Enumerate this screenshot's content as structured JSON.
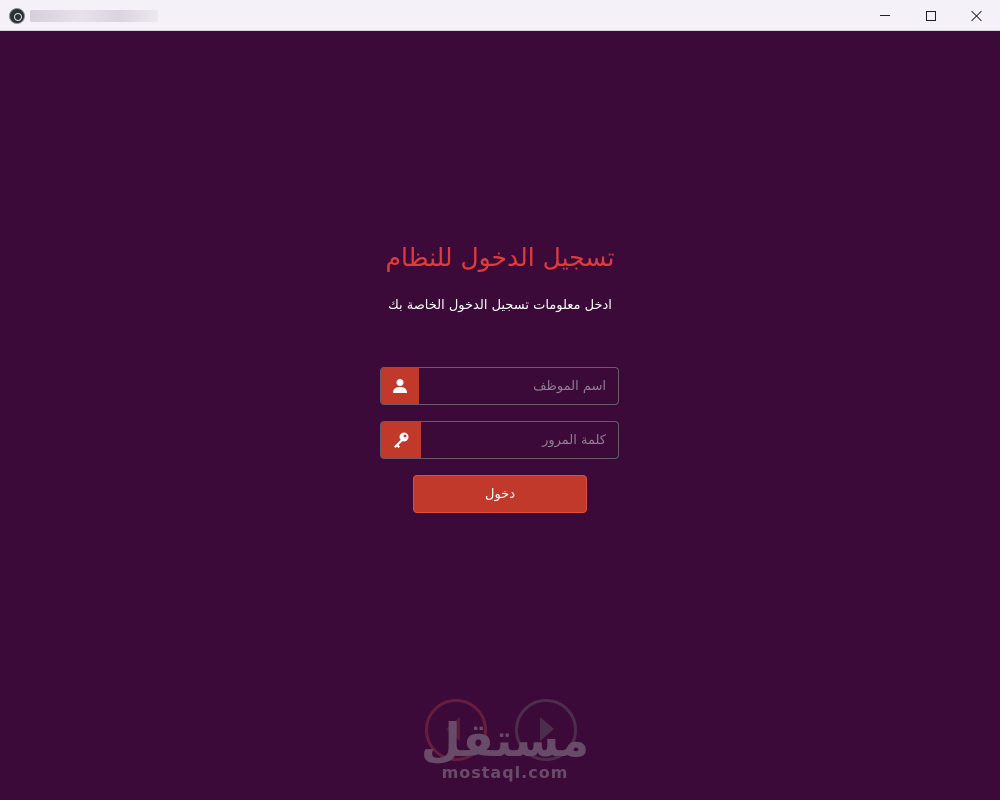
{
  "window": {
    "icon": "electron-app-icon",
    "controls": {
      "minimize": "minimize-icon",
      "maximize": "maximize-icon",
      "close": "close-icon"
    }
  },
  "login": {
    "title": "تسجيل الدخول للنظام",
    "subtitle": "ادخل معلومات تسجيل الدخول الخاصة بك",
    "username": {
      "placeholder": "اسم الموظف",
      "icon": "user-icon"
    },
    "password": {
      "placeholder": "كلمة المرور",
      "icon": "key-icon"
    },
    "submit_label": "دخول"
  },
  "watermark": {
    "arabic": "مستقل",
    "latin": "mostaql.com"
  },
  "colors": {
    "background": "#3b0a38",
    "accent": "#c0392b",
    "title": "#e23b3b"
  }
}
